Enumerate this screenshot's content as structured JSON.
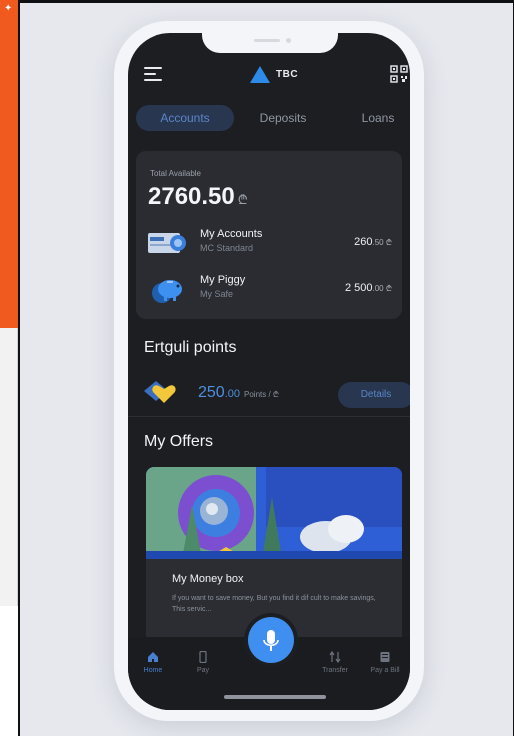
{
  "app": {
    "logo_text": "TBC"
  },
  "tabs": [
    {
      "label": "Accounts",
      "active": true
    },
    {
      "label": "Deposits",
      "active": false
    },
    {
      "label": "Loans",
      "active": false
    }
  ],
  "balance": {
    "total_label": "Total Available",
    "total_amount": "2760.50",
    "currency": "₾",
    "accounts": [
      {
        "title": "My Accounts",
        "subtitle": "MC Standard",
        "amount_main": "260",
        "amount_fraction": ".50 ₾"
      },
      {
        "title": "My Piggy",
        "subtitle": "My Safe",
        "amount_main": "2 500",
        "amount_fraction": ".00 ₾"
      }
    ]
  },
  "points": {
    "title": "Ertguli points",
    "amount_main": "250",
    "amount_fraction": ".00",
    "unit": "Points / ₾",
    "details_label": "Details"
  },
  "offers": {
    "title": "My Offers",
    "items": [
      {
        "title": "My Money box",
        "description": "If you want to save money, But you find it dif cult to make savings, This servic..."
      }
    ]
  },
  "bottom_nav": [
    {
      "label": "Home",
      "icon": "home-icon",
      "active": true
    },
    {
      "label": "Pay",
      "icon": "phone-icon",
      "active": false
    },
    {
      "label": "Transfer",
      "icon": "transfer-icon",
      "active": false
    },
    {
      "label": "Pay a Bill",
      "icon": "bill-icon",
      "active": false
    }
  ],
  "colors": {
    "accent": "#3f8ff0",
    "background": "#1c1e22",
    "card": "#2a2c31",
    "orange": "#f15a1f"
  }
}
